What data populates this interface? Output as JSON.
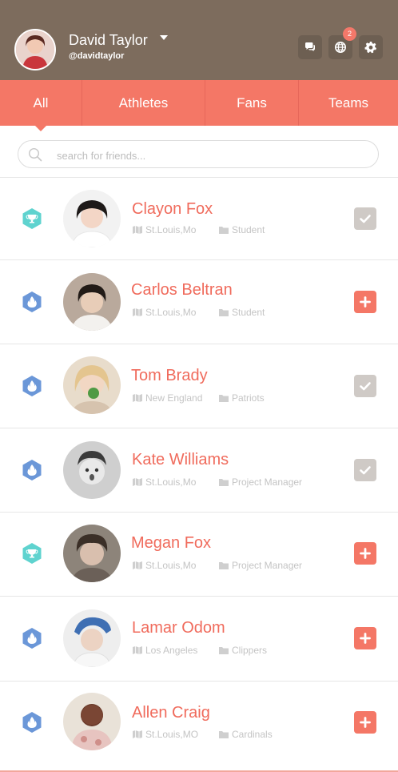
{
  "header": {
    "user_name": "David Taylor",
    "user_handle": "@davidtaylor",
    "notification_count": "2",
    "icons": [
      "chat-icon",
      "globe-icon",
      "gear-icon"
    ]
  },
  "tabs": [
    {
      "label": "All",
      "active": true
    },
    {
      "label": "Athletes",
      "active": false
    },
    {
      "label": "Fans",
      "active": false
    },
    {
      "label": "Teams",
      "active": false
    }
  ],
  "search": {
    "placeholder": "search for friends..."
  },
  "people": [
    {
      "name": "Clayon Fox",
      "location": "St.Louis,Mo",
      "org": "Student",
      "type": "trophy",
      "status": "added"
    },
    {
      "name": "Carlos Beltran",
      "location": "St.Louis,Mo",
      "org": "Student",
      "type": "flame",
      "status": "add"
    },
    {
      "name": "Tom Brady",
      "location": "New England",
      "org": "Patriots",
      "type": "flame",
      "status": "added"
    },
    {
      "name": "Kate Williams",
      "location": "St.Louis,Mo",
      "org": "Project Manager",
      "type": "flame",
      "status": "added"
    },
    {
      "name": "Megan Fox",
      "location": "St.Louis,Mo",
      "org": "Project Manager",
      "type": "trophy",
      "status": "add"
    },
    {
      "name": "Lamar Odom",
      "location": "Los Angeles",
      "org": "Clippers",
      "type": "flame",
      "status": "add"
    },
    {
      "name": "Allen Craig",
      "location": "St.Louis,MO",
      "org": "Cardinals",
      "type": "flame",
      "status": "add"
    }
  ],
  "colors": {
    "header": "#7d6c5d",
    "accent": "#f47766",
    "name": "#f06b5c",
    "trophy_hex": "#5fd3cf",
    "flame_hex": "#6b97d8",
    "added_button": "#cfcac6"
  }
}
